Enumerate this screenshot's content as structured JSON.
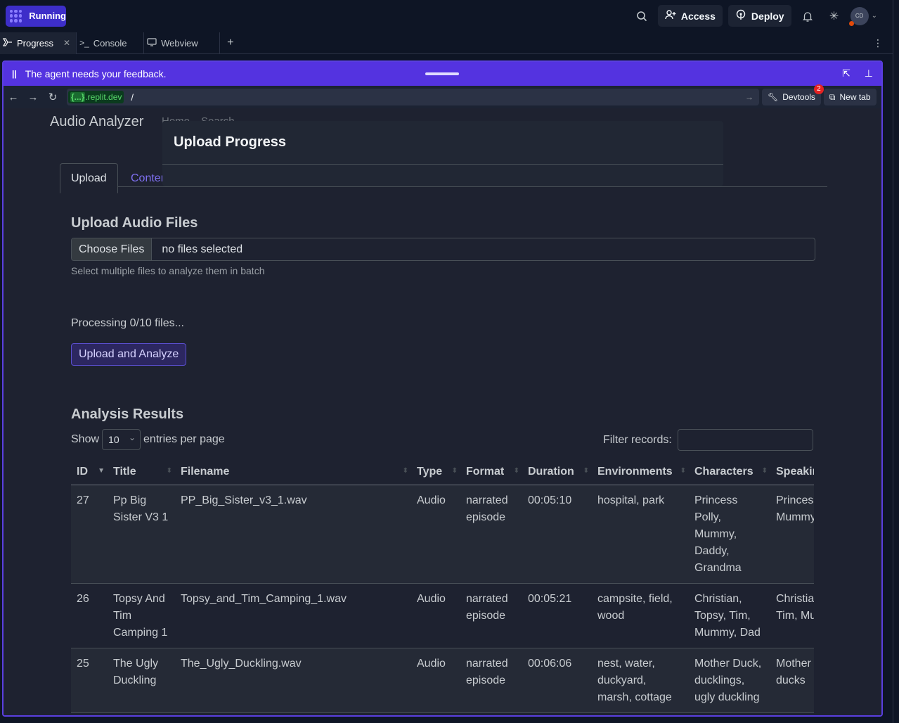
{
  "topbar": {
    "status": "Running",
    "access_label": "Access",
    "deploy_label": "Deploy",
    "avatar_initials": "CD"
  },
  "tabs": [
    {
      "label": "Progress",
      "icon": "progress-icon",
      "active": true
    },
    {
      "label": "Console",
      "icon": "terminal-icon"
    },
    {
      "label": "Webview",
      "icon": "monitor-icon"
    }
  ],
  "feedback": {
    "message": "The agent needs your feedback."
  },
  "urlbar": {
    "domain_prefix": "{...}",
    "domain_suffix": ".replit.dev",
    "path": "/",
    "devtools_label": "Devtools",
    "devtools_badge": "2",
    "newtab_label": "New tab"
  },
  "app": {
    "brand": "Audio Analyzer",
    "nav_home": "Home",
    "nav_search": "Search",
    "tab_upload": "Upload",
    "tab_content": "Conter",
    "modal_title": "Upload Progress",
    "upload_heading": "Upload Audio Files",
    "choose_files": "Choose Files",
    "no_files": "no files selected",
    "help_text": "Select multiple files to analyze them in batch",
    "processing": "Processing 0/10 files...",
    "upload_button": "Upload and Analyze",
    "results_heading": "Analysis Results",
    "show_label": "Show",
    "show_value": "10",
    "entries_label": "entries per page",
    "filter_label": "Filter records:"
  },
  "table": {
    "headers": [
      "ID",
      "Title",
      "Filename",
      "Type",
      "Format",
      "Duration",
      "Environments",
      "Characters",
      "Speakin"
    ],
    "rows": [
      {
        "id": "27",
        "title": "Pp Big Sister V3 1",
        "filename": "PP_Big_Sister_v3_1.wav",
        "type": "Audio",
        "format": "narrated episode",
        "duration": "00:05:10",
        "environments": "hospital, park",
        "characters": "Princess Polly, Mummy, Daddy, Grandma",
        "speakers": "Princess Polly, Mummy, Daddy"
      },
      {
        "id": "26",
        "title": "Topsy And Tim Camping 1",
        "filename": "Topsy_and_Tim_Camping_1.wav",
        "type": "Audio",
        "format": "narrated episode",
        "duration": "00:05:21",
        "environments": "campsite, field, wood",
        "characters": "Christian, Topsy, Tim, Mummy, Dad",
        "speakers": "Christian, Topsy, Tim, Mummy, Dad"
      },
      {
        "id": "25",
        "title": "The Ugly Duckling",
        "filename": "The_Ugly_Duckling.wav",
        "type": "Audio",
        "format": "narrated episode",
        "duration": "00:06:06",
        "environments": "nest, water, duckyard, marsh, cottage",
        "characters": "Mother Duck, ducklings, ugly duckling",
        "speakers": "Mother Duck, wild ducks"
      }
    ]
  }
}
